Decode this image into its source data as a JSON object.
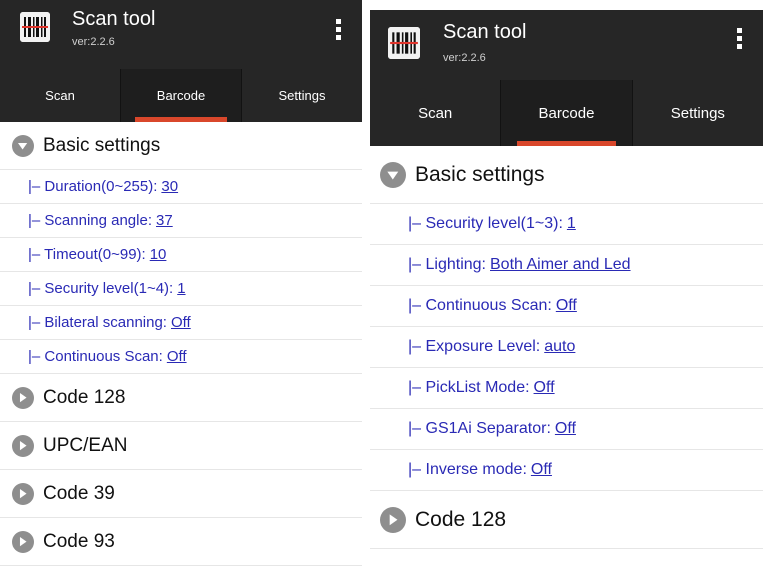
{
  "left": {
    "app": {
      "title": "Scan tool",
      "version": "ver:2.2.6"
    },
    "tabs": [
      {
        "label": "Scan",
        "active": false
      },
      {
        "label": "Barcode",
        "active": true
      },
      {
        "label": "Settings",
        "active": false
      }
    ],
    "basic_settings": {
      "label": "Basic settings",
      "expanded": true,
      "items": [
        {
          "label": "|– Duration(0~255):",
          "value": "30"
        },
        {
          "label": "|– Scanning angle:",
          "value": "37"
        },
        {
          "label": "|– Timeout(0~99):",
          "value": "10"
        },
        {
          "label": "|– Security level(1~4):",
          "value": "1"
        },
        {
          "label": "|– Bilateral scanning:",
          "value": "Off"
        },
        {
          "label": "|– Continuous Scan:",
          "value": "Off"
        }
      ]
    },
    "groups": [
      {
        "label": "Code 128",
        "expanded": false
      },
      {
        "label": "UPC/EAN",
        "expanded": false
      },
      {
        "label": "Code 39",
        "expanded": false
      },
      {
        "label": "Code 93",
        "expanded": false
      }
    ]
  },
  "right": {
    "app": {
      "title": "Scan tool",
      "version": "ver:2.2.6"
    },
    "tabs": [
      {
        "label": "Scan",
        "active": false
      },
      {
        "label": "Barcode",
        "active": true
      },
      {
        "label": "Settings",
        "active": false
      }
    ],
    "basic_settings": {
      "label": "Basic settings",
      "expanded": true,
      "items": [
        {
          "label": "|– Security level(1~3):",
          "value": "1"
        },
        {
          "label": "|– Lighting:",
          "value": "Both Aimer and Led"
        },
        {
          "label": "|– Continuous Scan:",
          "value": "Off"
        },
        {
          "label": "|– Exposure Level:",
          "value": "auto"
        },
        {
          "label": "|– PickList Mode:",
          "value": "Off"
        },
        {
          "label": "|– GS1Ai Separator:",
          "value": "Off"
        },
        {
          "label": "|– Inverse mode:",
          "value": "Off"
        }
      ]
    },
    "groups": [
      {
        "label": "Code 128",
        "expanded": false
      }
    ]
  },
  "icons": {
    "app_icon": "barcode-scanner-icon",
    "menu": "overflow-menu-icon",
    "expanded": "chevron-down-circle-icon",
    "collapsed": "chevron-right-circle-icon"
  },
  "colors": {
    "toolbar": "#262626",
    "tab_indicator": "#d9472b",
    "setting_text": "#2a2ab5",
    "arrow_circle": "#8e8e8e"
  }
}
